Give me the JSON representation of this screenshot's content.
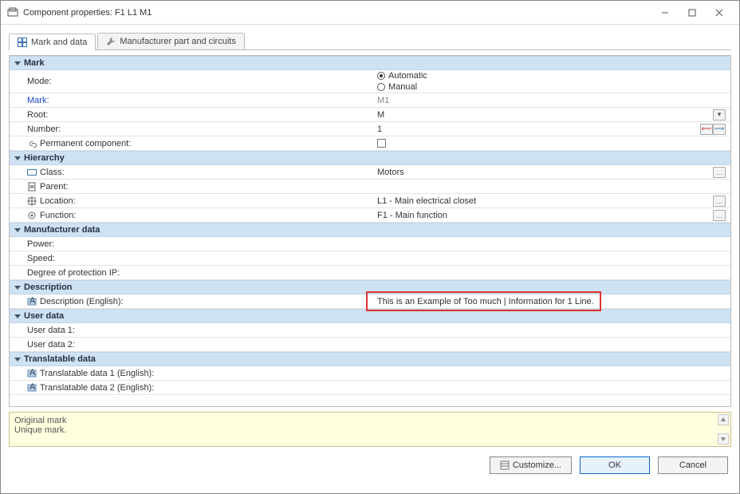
{
  "window": {
    "title": "Component properties: F1 L1 M1"
  },
  "tabs": {
    "mark_and_data": "Mark and data",
    "manufacturer_part": "Manufacturer part and circuits"
  },
  "sections": {
    "mark": {
      "title": "Mark",
      "mode_label": "Mode:",
      "mode_auto": "Automatic",
      "mode_manual": "Manual",
      "mark_label": "Mark:",
      "mark_value": "M1",
      "root_label": "Root:",
      "root_value": "M",
      "number_label": "Number:",
      "number_value": "1",
      "permanent_label": "Permanent component:"
    },
    "hierarchy": {
      "title": "Hierarchy",
      "class_label": "Class:",
      "class_value": "Motors",
      "parent_label": "Parent:",
      "location_label": "Location:",
      "location_value": "L1 - Main electrical closet",
      "function_label": "Function:",
      "function_value": "F1 - Main function"
    },
    "mfr": {
      "title": "Manufacturer data",
      "power_label": "Power:",
      "speed_label": "Speed:",
      "ip_label": "Degree of protection IP:"
    },
    "desc": {
      "title": "Description",
      "desc_en_label": "Description (English):",
      "desc_en_value": "This is an Example of Too much | Information for 1 Line."
    },
    "user": {
      "title": "User data",
      "u1_label": "User data 1:",
      "u2_label": "User data 2:"
    },
    "trans": {
      "title": "Translatable data",
      "t1_label": "Translatable data 1 (English):",
      "t2_label": "Translatable data 2 (English):"
    }
  },
  "footer_note": {
    "line1": "Original mark",
    "line2": "Unique mark."
  },
  "buttons": {
    "customize": "Customize...",
    "ok": "OK",
    "cancel": "Cancel"
  }
}
